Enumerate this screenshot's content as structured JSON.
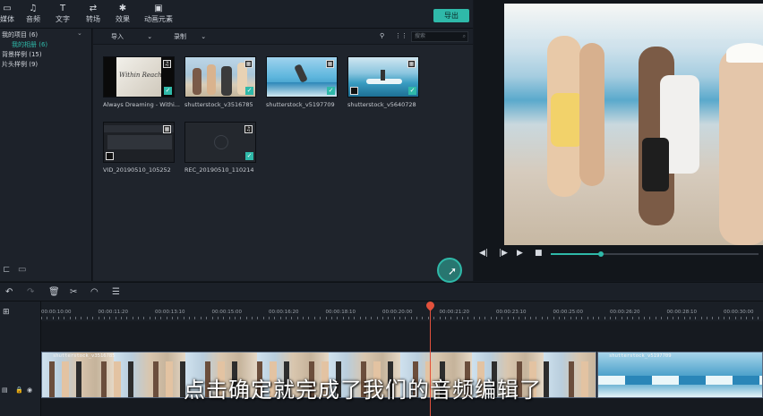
{
  "nav": {
    "tabs": [
      {
        "label": "媒体",
        "icon": "folder-icon"
      },
      {
        "label": "音频",
        "icon": "music-icon"
      },
      {
        "label": "文字",
        "icon": "text-icon"
      },
      {
        "label": "转场",
        "icon": "transition-icon"
      },
      {
        "label": "效果",
        "icon": "effects-icon"
      },
      {
        "label": "动画元素",
        "icon": "elements-icon"
      }
    ],
    "export_label": "导出"
  },
  "sidebar": {
    "items": [
      {
        "label": "我的项目 (6)"
      },
      {
        "label": "我的相册 (6)"
      },
      {
        "label": "背景样例 (15)"
      },
      {
        "label": "片头样例 (9)"
      }
    ]
  },
  "media_toolbar": {
    "import_label": "导入",
    "record_label": "录制",
    "search_placeholder": "搜索"
  },
  "media_items": [
    {
      "label": "Always Dreaming - Withi...",
      "thumb_text": "Within Reach",
      "badge": "♫",
      "checked": true
    },
    {
      "label": "shutterstock_v3516785",
      "badge": "▦",
      "checked": true
    },
    {
      "label": "shutterstock_v5197709",
      "badge": "▦",
      "checked": true
    },
    {
      "label": "shutterstock_v5640728",
      "badge": "▦",
      "checked": true
    },
    {
      "label": "VID_20190510_105252",
      "badge": "▦",
      "checked": false
    },
    {
      "label": "REC_20190510_110214",
      "badge": "♫",
      "checked": true
    }
  ],
  "timeline": {
    "ticks": [
      "00:00:10:00",
      "00:00:11:20",
      "00:00:13:10",
      "00:00:15:00",
      "00:00:16:20",
      "00:00:18:10",
      "00:00:20:00",
      "00:00:21:20",
      "00:00:23:10",
      "00:00:25:00",
      "00:00:26:20",
      "00:00:28:10",
      "00:00:30:00"
    ],
    "clips": [
      {
        "name": "shutterstock_v3516785"
      },
      {
        "name": "shutterstock_v5197709"
      }
    ]
  },
  "subtitle": "点击确定就完成了我们的音频编辑了",
  "colors": {
    "accent": "#2fb9a9",
    "playhead": "#e2513c"
  }
}
